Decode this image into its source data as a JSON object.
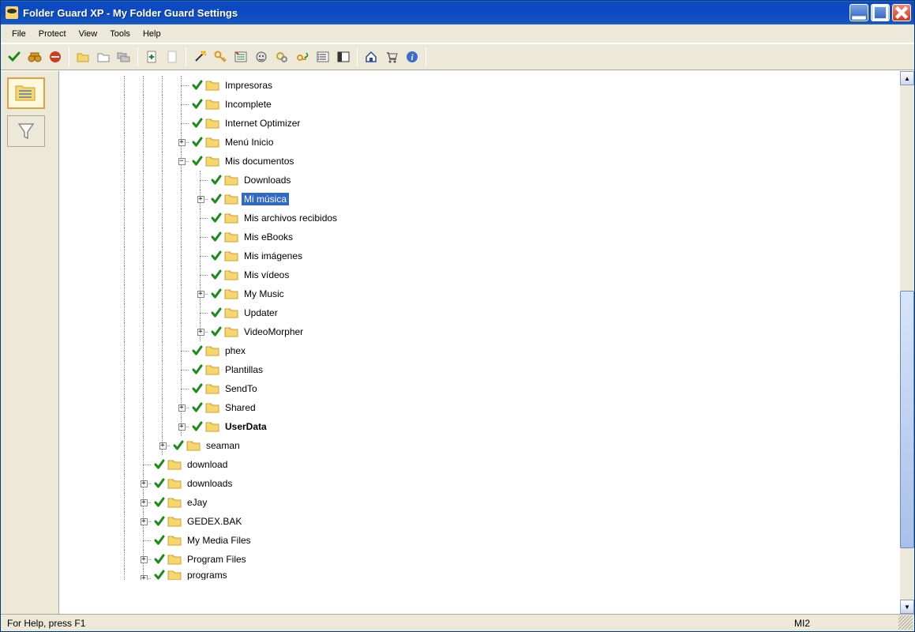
{
  "title": "Folder Guard XP - My Folder Guard Settings",
  "menu": {
    "file": "File",
    "protect": "Protect",
    "view": "View",
    "tools": "Tools",
    "help": "Help"
  },
  "toolbar": {
    "g1": [
      {
        "name": "check-icon",
        "type": "check"
      },
      {
        "name": "binoculars-icon",
        "type": "binoc"
      },
      {
        "name": "stop-icon",
        "type": "stop"
      }
    ],
    "g2": [
      {
        "name": "folder-open-icon",
        "type": "folder-open"
      },
      {
        "name": "folder-new-icon",
        "type": "folder-new"
      },
      {
        "name": "folders-icon",
        "type": "folders"
      }
    ],
    "g3": [
      {
        "name": "page-add-icon",
        "type": "page-add"
      },
      {
        "name": "page-icon",
        "type": "page"
      }
    ],
    "g4": [
      {
        "name": "wand-icon",
        "type": "wand"
      },
      {
        "name": "key-icon",
        "type": "key"
      },
      {
        "name": "options-icon",
        "type": "options"
      },
      {
        "name": "face-icon",
        "type": "face"
      },
      {
        "name": "gears-icon",
        "type": "gears"
      },
      {
        "name": "undo-key-icon",
        "type": "undo-key"
      },
      {
        "name": "list-icon",
        "type": "list"
      },
      {
        "name": "panel-icon",
        "type": "panel"
      }
    ],
    "g5": [
      {
        "name": "home-icon",
        "type": "home"
      },
      {
        "name": "cart-icon",
        "type": "cart"
      },
      {
        "name": "info-icon",
        "type": "info"
      }
    ]
  },
  "side": [
    {
      "name": "tree-view-button",
      "type": "treeview",
      "active": true
    },
    {
      "name": "filter-view-button",
      "type": "filter",
      "active": false
    }
  ],
  "tree": [
    {
      "d": 4,
      "pre": [
        "line",
        "line",
        "line",
        "empty"
      ],
      "exp": null,
      "label": "Impresoras"
    },
    {
      "d": 4,
      "pre": [
        "line",
        "line",
        "line",
        "empty"
      ],
      "exp": null,
      "label": "Incomplete"
    },
    {
      "d": 4,
      "pre": [
        "line",
        "line",
        "line",
        "empty"
      ],
      "exp": null,
      "label": "Internet Optimizer"
    },
    {
      "d": 4,
      "pre": [
        "line",
        "line",
        "line"
      ],
      "exp": "plus",
      "label": "Menú Inicio"
    },
    {
      "d": 4,
      "pre": [
        "line",
        "line",
        "line"
      ],
      "exp": "minus",
      "label": "Mis documentos"
    },
    {
      "d": 5,
      "pre": [
        "line",
        "line",
        "line",
        "line",
        "empty"
      ],
      "exp": null,
      "label": "Downloads"
    },
    {
      "d": 5,
      "pre": [
        "line",
        "line",
        "line",
        "line"
      ],
      "exp": "plus",
      "label": "Mi música",
      "selected": true
    },
    {
      "d": 5,
      "pre": [
        "line",
        "line",
        "line",
        "line",
        "empty"
      ],
      "exp": null,
      "label": "Mis archivos recibidos"
    },
    {
      "d": 5,
      "pre": [
        "line",
        "line",
        "line",
        "line",
        "empty"
      ],
      "exp": null,
      "label": "Mis eBooks"
    },
    {
      "d": 5,
      "pre": [
        "line",
        "line",
        "line",
        "line",
        "empty"
      ],
      "exp": null,
      "label": "Mis imágenes"
    },
    {
      "d": 5,
      "pre": [
        "line",
        "line",
        "line",
        "line",
        "empty"
      ],
      "exp": null,
      "label": "Mis vídeos"
    },
    {
      "d": 5,
      "pre": [
        "line",
        "line",
        "line",
        "line"
      ],
      "exp": "plus",
      "label": "My Music"
    },
    {
      "d": 5,
      "pre": [
        "line",
        "line",
        "line",
        "line",
        "empty"
      ],
      "exp": null,
      "label": "Updater"
    },
    {
      "d": 5,
      "pre": [
        "line",
        "line",
        "line",
        "line"
      ],
      "exp": "plus",
      "label": "VideoMorpher"
    },
    {
      "d": 4,
      "pre": [
        "line",
        "line",
        "line",
        "empty"
      ],
      "exp": null,
      "label": "phex"
    },
    {
      "d": 4,
      "pre": [
        "line",
        "line",
        "line",
        "empty"
      ],
      "exp": null,
      "label": "Plantillas"
    },
    {
      "d": 4,
      "pre": [
        "line",
        "line",
        "line",
        "empty"
      ],
      "exp": null,
      "label": "SendTo"
    },
    {
      "d": 4,
      "pre": [
        "line",
        "line",
        "line"
      ],
      "exp": "plus",
      "label": "Shared"
    },
    {
      "d": 4,
      "pre": [
        "line",
        "line",
        "line"
      ],
      "exp": "plus",
      "label": "UserData",
      "bold": true
    },
    {
      "d": 3,
      "pre": [
        "line",
        "line"
      ],
      "exp": "plus",
      "label": "seaman"
    },
    {
      "d": 2,
      "pre": [
        "line",
        "empty"
      ],
      "exp": null,
      "label": "download"
    },
    {
      "d": 2,
      "pre": [
        "line"
      ],
      "exp": "plus",
      "label": "downloads"
    },
    {
      "d": 2,
      "pre": [
        "line"
      ],
      "exp": "plus",
      "label": "eJay"
    },
    {
      "d": 2,
      "pre": [
        "line"
      ],
      "exp": "plus",
      "label": "GEDEX.BAK"
    },
    {
      "d": 2,
      "pre": [
        "line",
        "empty"
      ],
      "exp": null,
      "label": "My Media Files"
    },
    {
      "d": 2,
      "pre": [
        "line"
      ],
      "exp": "plus",
      "label": "Program Files"
    },
    {
      "d": 2,
      "pre": [
        "line"
      ],
      "exp": "plus",
      "label": "programs",
      "cut": true
    }
  ],
  "scrollbar": {
    "thumb_top_pct": 40,
    "thumb_height_pct": 50
  },
  "status": {
    "left": "For Help, press F1",
    "right": "MI2"
  }
}
